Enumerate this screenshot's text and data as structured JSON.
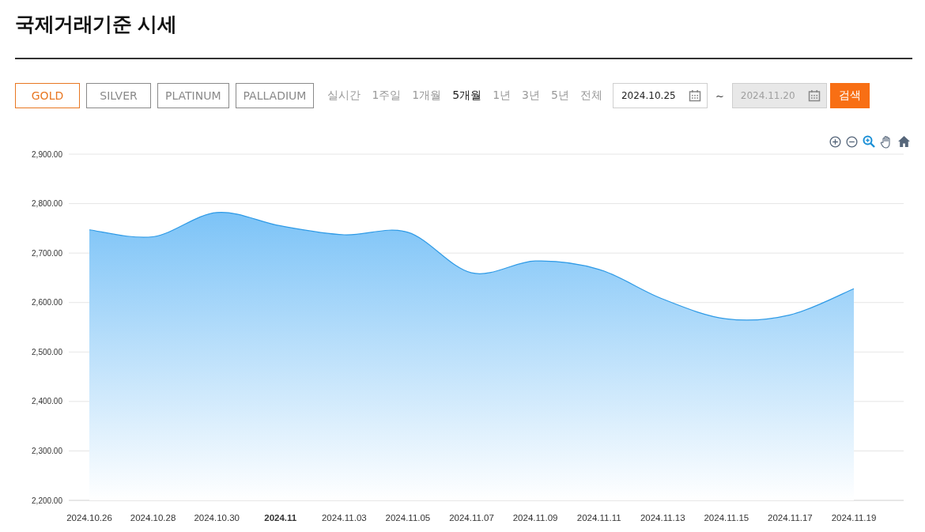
{
  "title": "국제거래기준 시세",
  "metals": [
    {
      "label": "GOLD",
      "selected": true
    },
    {
      "label": "SILVER",
      "selected": false
    },
    {
      "label": "PLATINUM",
      "selected": false
    },
    {
      "label": "PALLADIUM",
      "selected": false
    }
  ],
  "periods": [
    {
      "label": "실시간",
      "selected": false
    },
    {
      "label": "1주일",
      "selected": false
    },
    {
      "label": "1개월",
      "selected": false
    },
    {
      "label": "5개월",
      "selected": true
    },
    {
      "label": "1년",
      "selected": false
    },
    {
      "label": "3년",
      "selected": false
    },
    {
      "label": "5년",
      "selected": false
    },
    {
      "label": "전체",
      "selected": false
    }
  ],
  "date_from": {
    "value": "2024.10.25",
    "disabled": false
  },
  "range_separator": "~",
  "date_to": {
    "value": "2024.11.20",
    "disabled": true
  },
  "search_button": "검색",
  "chart_data": {
    "type": "area",
    "x": [
      "2024.10.26",
      "2024.10.28",
      "2024.10.30",
      "2024.11",
      "2024.11.03",
      "2024.11.05",
      "2024.11.07",
      "2024.11.09",
      "2024.11.11",
      "2024.11.13",
      "2024.11.15",
      "2024.11.17",
      "2024.11.19"
    ],
    "series": [
      {
        "color": "#2e9ae6",
        "values": [
          2747,
          2733,
          2782,
          2755,
          2737,
          2742,
          2660,
          2684,
          2667,
          2607,
          2567,
          2575,
          2628
        ]
      }
    ],
    "grid": true,
    "ylim": [
      2200,
      2900
    ],
    "yticks": [
      {
        "value": 2200,
        "label": "2,200.00"
      },
      {
        "value": 2300,
        "label": "2,300.00"
      },
      {
        "value": 2400,
        "label": "2,400.00"
      },
      {
        "value": 2500,
        "label": "2,500.00"
      },
      {
        "value": 2600,
        "label": "2,600.00"
      },
      {
        "value": 2700,
        "label": "2,700.00"
      },
      {
        "value": 2800,
        "label": "2,800.00"
      },
      {
        "value": 2900,
        "label": "2,900.00"
      }
    ]
  }
}
